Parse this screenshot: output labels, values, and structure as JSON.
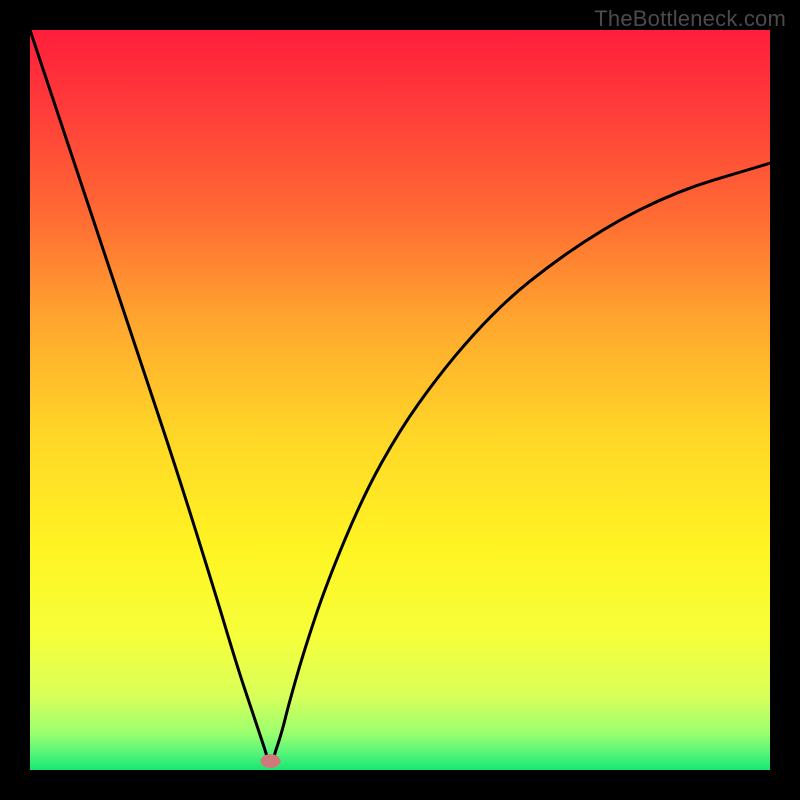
{
  "watermark": "TheBottleneck.com",
  "chart_data": {
    "type": "line",
    "title": "",
    "xlabel": "",
    "ylabel": "",
    "xlim": [
      0,
      1
    ],
    "ylim": [
      0,
      1
    ],
    "optimum_x": 0.325,
    "marker": {
      "x": 0.325,
      "y": 0.012,
      "color": "#cf7a7a"
    },
    "series": [
      {
        "name": "curve",
        "x": [
          0.0,
          0.05,
          0.1,
          0.15,
          0.2,
          0.25,
          0.28,
          0.3,
          0.31,
          0.32,
          0.325,
          0.33,
          0.34,
          0.35,
          0.37,
          0.4,
          0.45,
          0.5,
          0.55,
          0.6,
          0.65,
          0.7,
          0.75,
          0.8,
          0.85,
          0.9,
          0.95,
          1.0
        ],
        "y": [
          1.0,
          0.85,
          0.7,
          0.55,
          0.4,
          0.24,
          0.14,
          0.08,
          0.05,
          0.02,
          0.0,
          0.02,
          0.05,
          0.09,
          0.16,
          0.25,
          0.37,
          0.46,
          0.53,
          0.59,
          0.64,
          0.68,
          0.715,
          0.745,
          0.77,
          0.79,
          0.805,
          0.82
        ]
      }
    ],
    "gradient_stops": [
      {
        "offset": 0.0,
        "color": "#ff1e3c"
      },
      {
        "offset": 0.1,
        "color": "#ff3a3a"
      },
      {
        "offset": 0.25,
        "color": "#ff6a33"
      },
      {
        "offset": 0.4,
        "color": "#ffa92e"
      },
      {
        "offset": 0.55,
        "color": "#ffd727"
      },
      {
        "offset": 0.7,
        "color": "#fff423"
      },
      {
        "offset": 0.82,
        "color": "#f6ff3a"
      },
      {
        "offset": 0.9,
        "color": "#d8ff5a"
      },
      {
        "offset": 0.95,
        "color": "#9bff6e"
      },
      {
        "offset": 0.975,
        "color": "#5cf57a"
      },
      {
        "offset": 1.0,
        "color": "#17e872"
      }
    ]
  }
}
